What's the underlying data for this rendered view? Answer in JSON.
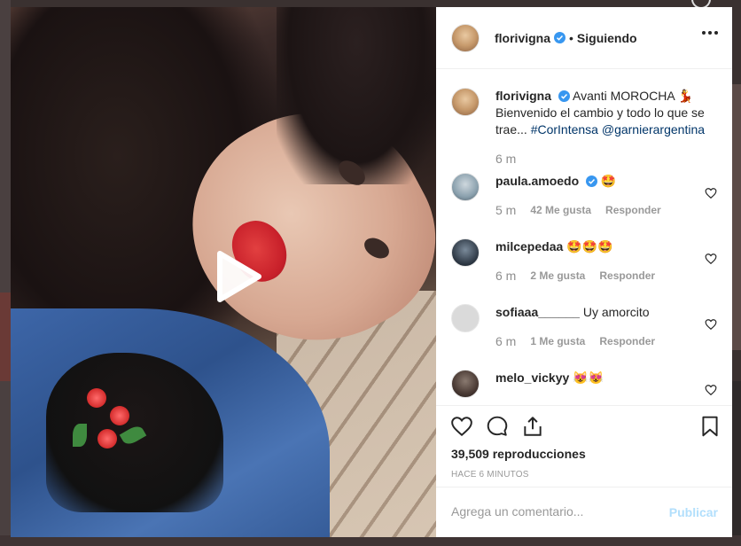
{
  "post": {
    "username": "florivigna",
    "separator": "•",
    "follow_status": "Siguiendo",
    "caption_user": "florivigna",
    "caption_text": "Avanti MOROCHA 💃 Bienvenido el cambio y todo lo que se trae... ",
    "hashtag": "#CorIntensa",
    "mention": "@garnierargentina",
    "caption_time": "6 m",
    "views": "39,509 reproducciones",
    "posted_ago": "HACE 6 MINUTOS"
  },
  "comments": [
    {
      "user": "paula.amoedo",
      "verified": true,
      "text": "🤩",
      "time": "5 m",
      "likes": "42 Me gusta",
      "reply": "Responder"
    },
    {
      "user": "milcepedaa",
      "verified": false,
      "text": "🤩🤩🤩",
      "time": "6 m",
      "likes": "2 Me gusta",
      "reply": "Responder"
    },
    {
      "user": "sofiaaa______",
      "verified": false,
      "text": "Uy amorcito",
      "time": "6 m",
      "likes": "1 Me gusta",
      "reply": "Responder"
    },
    {
      "user": "melo_vickyy",
      "verified": false,
      "text": "😻😻",
      "time": "",
      "likes": "",
      "reply": ""
    }
  ],
  "comment_box": {
    "placeholder": "Agrega un comentario...",
    "publish_label": "Publicar"
  },
  "colors": {
    "verified_blue": "#3897f0",
    "publish_disabled": "#b2dffc",
    "link": "#003569"
  }
}
